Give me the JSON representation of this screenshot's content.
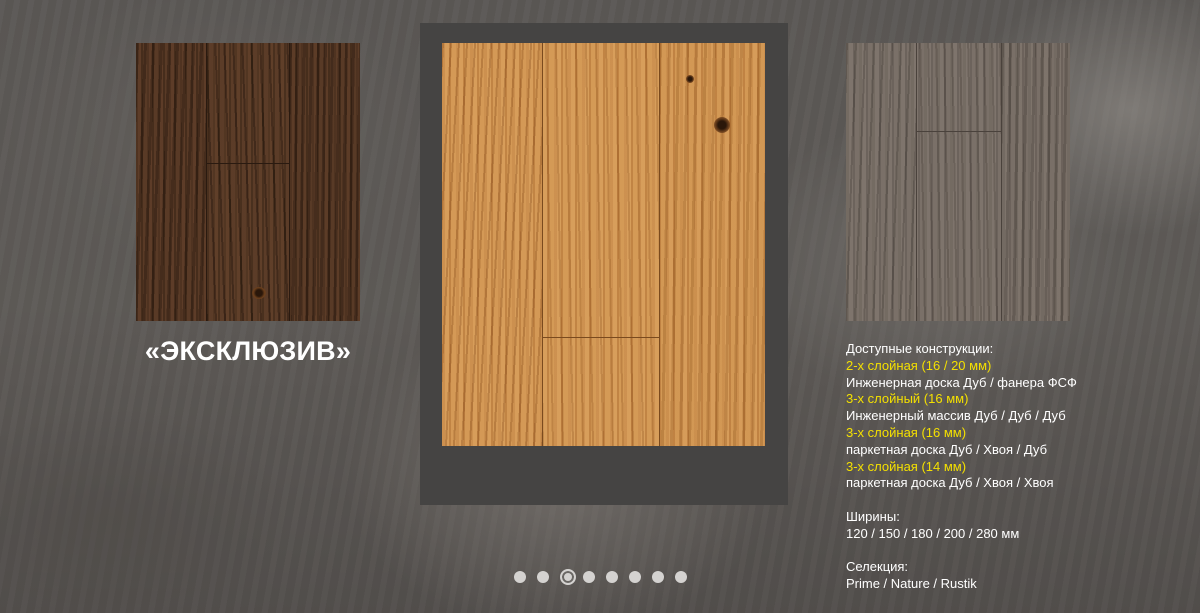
{
  "collection": {
    "title": "«ЭКСКЛЮЗИВ»"
  },
  "description": {
    "constructions_heading": "Доступные конструкции:",
    "constructions": [
      {
        "type": "2-х слойная (16 / 20 мм)",
        "composition": "Инженерная доска Дуб / фанера ФСФ"
      },
      {
        "type": "3-х слойный (16 мм)",
        "composition": "Инженерный массив Дуб / Дуб / Дуб"
      },
      {
        "type": "3-х слойная (16 мм)",
        "composition": "паркетная доска Дуб / Хвоя / Дуб"
      },
      {
        "type": "3-х слойная (14 мм)",
        "composition": "паркетная доска Дуб / Хвоя / Хвоя"
      }
    ],
    "widths_heading": "Ширины:",
    "widths": "120 / 150 / 180 / 200 / 280 мм",
    "selection_heading": "Селекция:",
    "selection": "Prime / Nature / Rustik"
  },
  "swatches": {
    "left": {
      "color": "#4e3221"
    },
    "center": {
      "color": "#c98d4c"
    },
    "right": {
      "color": "#726960"
    }
  },
  "colors": {
    "highlight": "#f4e000",
    "text": "#ffffff",
    "frame": "#454443"
  },
  "pagination": {
    "count": 8,
    "active_index": 2
  }
}
